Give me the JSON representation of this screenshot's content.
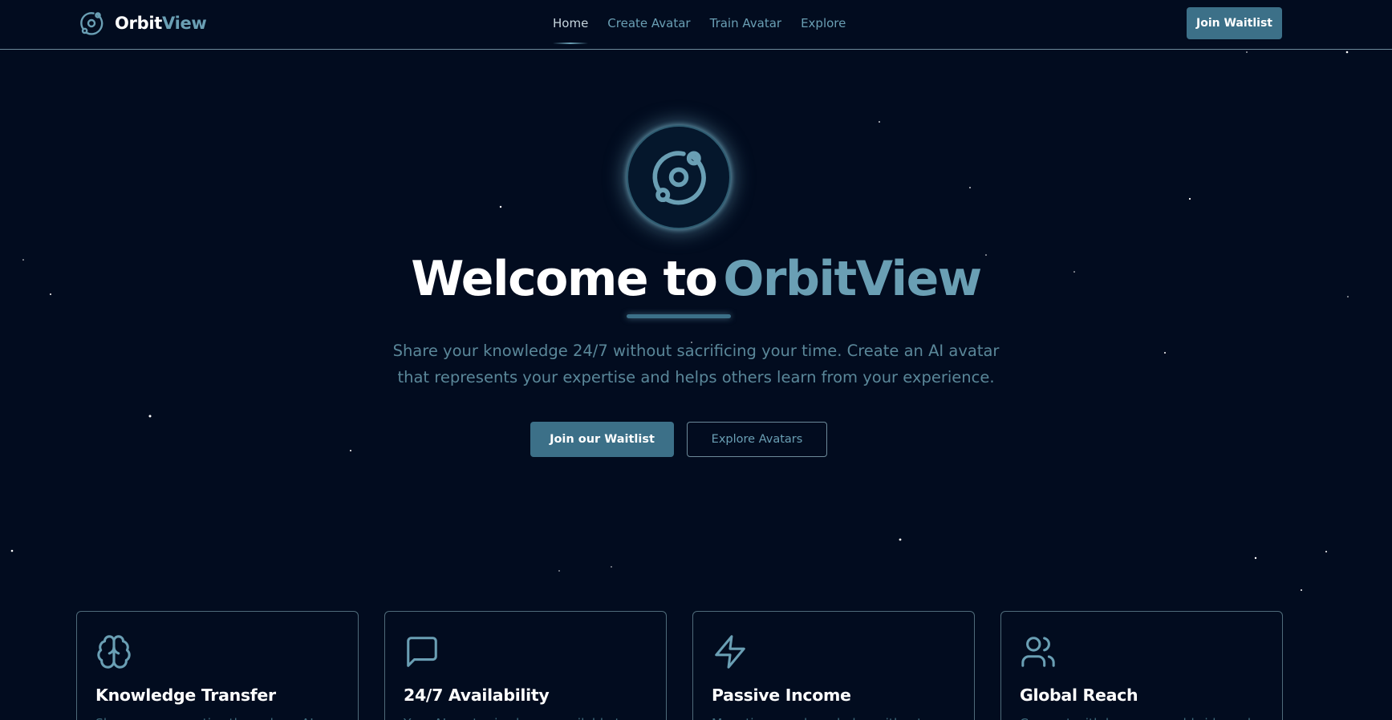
{
  "brand": {
    "name_part1": "Orbit",
    "name_part2": "View",
    "logo_icon": "orbit-icon"
  },
  "nav": {
    "items": [
      {
        "label": "Home",
        "active": true
      },
      {
        "label": "Create Avatar",
        "active": false
      },
      {
        "label": "Train Avatar",
        "active": false
      },
      {
        "label": "Explore",
        "active": false
      }
    ]
  },
  "header_cta": {
    "label": "Join Waitlist"
  },
  "hero": {
    "icon": "orbit-icon",
    "title_part1": "Welcome to",
    "title_part2": "OrbitView",
    "subtitle_line1": "Share your knowledge 24/7 without sacrificing your time. Create an AI avatar",
    "subtitle_line2": "that represents your expertise and helps others learn from your experience.",
    "primary_button": "Join our Waitlist",
    "secondary_button": "Explore Avatars"
  },
  "features": [
    {
      "icon": "brain-icon",
      "title": "Knowledge Transfer",
      "description": "Share your expertise through an AI"
    },
    {
      "icon": "message-icon",
      "title": "24/7 Availability",
      "description": "Your AI avatar is always available to"
    },
    {
      "icon": "lightning-icon",
      "title": "Passive Income",
      "description": "Monetize your knowledge without"
    },
    {
      "icon": "users-icon",
      "title": "Global Reach",
      "description": "Connect with learners worldwide and"
    }
  ],
  "colors": {
    "background": "#020c1f",
    "accent": "#6a9fb4",
    "button": "#3c7088",
    "muted_text": "#5a8799",
    "border": "#6d8a9a"
  }
}
